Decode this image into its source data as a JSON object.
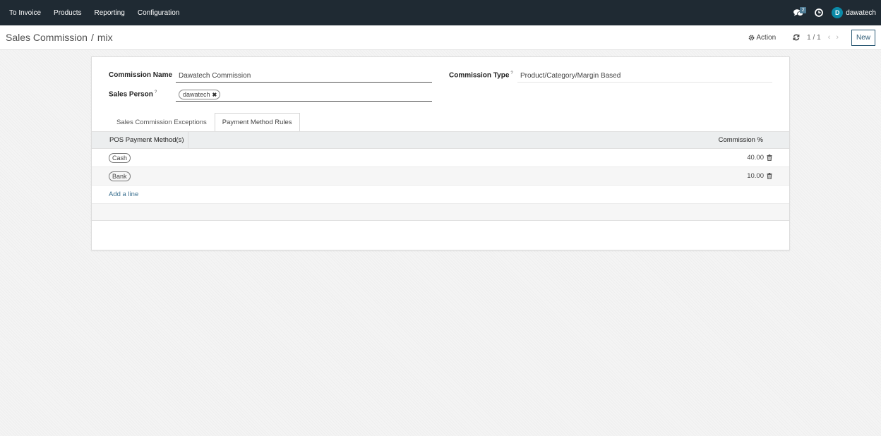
{
  "navbar": {
    "menu": [
      "To Invoice",
      "Products",
      "Reporting",
      "Configuration"
    ],
    "messages_count": "2",
    "user_initial": "D",
    "user_name": "dawatech"
  },
  "control_panel": {
    "breadcrumb_parent": "Sales Commission",
    "breadcrumb_separator": "/",
    "breadcrumb_current": "mix",
    "action_label": "Action",
    "pager": "1 / 1",
    "new_label": "New"
  },
  "form": {
    "commission_name_label": "Commission Name",
    "commission_name_value": "Dawatech Commission",
    "sales_person_label": "Sales Person",
    "sales_person_tag": "dawatech",
    "commission_type_label": "Commission Type",
    "commission_type_value": "Product/Category/Margin Based",
    "help_mark": "?"
  },
  "tabs": [
    "Sales Commission Exceptions",
    "Payment Method Rules"
  ],
  "table": {
    "columns": [
      "POS Payment Method(s)",
      "Commission %"
    ],
    "rows": [
      {
        "method": "Cash",
        "commission": "40.00"
      },
      {
        "method": "Bank",
        "commission": "10.00"
      }
    ],
    "add_line": "Add a line"
  },
  "colors": {
    "navbar": "#1f2a33",
    "accent": "#2c5a75",
    "avatar": "#0b8aa8"
  },
  "icons": [
    "chat-icon",
    "clock-icon",
    "gear-icon",
    "refresh-icon",
    "chevron-left-icon",
    "chevron-right-icon",
    "trash-icon",
    "close-icon"
  ]
}
